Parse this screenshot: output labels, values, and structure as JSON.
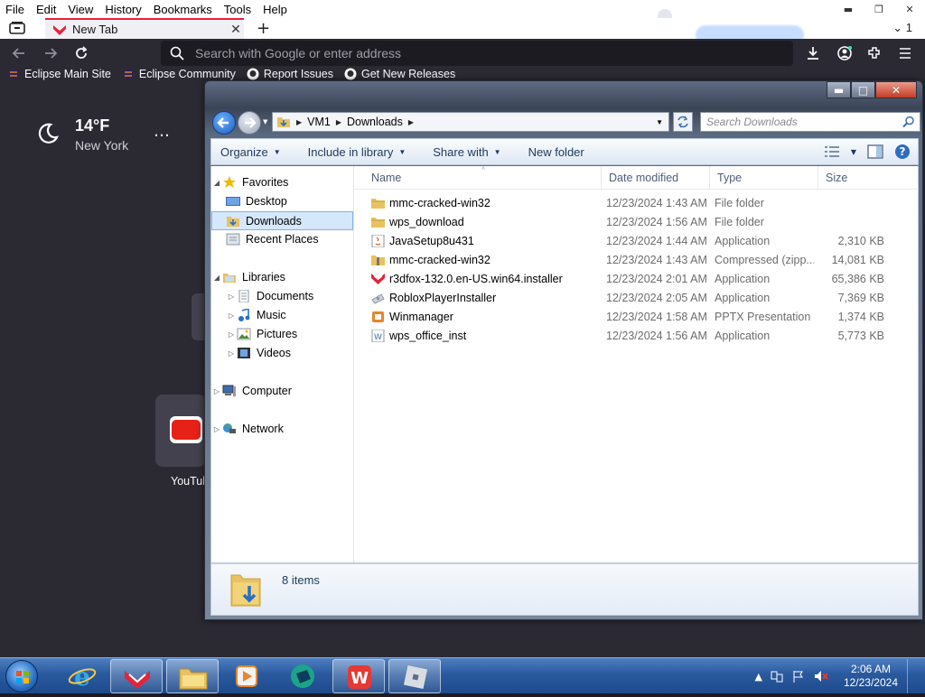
{
  "browser": {
    "menu": [
      "File",
      "Edit",
      "View",
      "History",
      "Bookmarks",
      "Tools",
      "Help"
    ],
    "tab_title": "New Tab",
    "tab_count": "1",
    "url_placeholder": "Search with Google or enter address",
    "bookmarks": [
      {
        "label": "Eclipse Main Site",
        "icon": "eclipse-icon"
      },
      {
        "label": "Eclipse Community",
        "icon": "eclipse-icon"
      },
      {
        "label": "Report Issues",
        "icon": "github-icon"
      },
      {
        "label": "Get New Releases",
        "icon": "github-icon"
      }
    ],
    "weather": {
      "temp": "14°F",
      "city": "New York"
    },
    "tiles": [
      {
        "label": "YouTube"
      }
    ]
  },
  "explorer": {
    "breadcrumb": [
      "VM1",
      "Downloads"
    ],
    "search_placeholder": "Search Downloads",
    "toolbar": {
      "organize": "Organize",
      "include": "Include in library",
      "share": "Share with",
      "new_folder": "New folder"
    },
    "nav": {
      "favorites": "Favorites",
      "desktop": "Desktop",
      "downloads": "Downloads",
      "recent": "Recent Places",
      "libraries": "Libraries",
      "documents": "Documents",
      "music": "Music",
      "pictures": "Pictures",
      "videos": "Videos",
      "computer": "Computer",
      "network": "Network"
    },
    "columns": {
      "name": "Name",
      "date": "Date modified",
      "type": "Type",
      "size": "Size"
    },
    "files": [
      {
        "name": "mmc-cracked-win32",
        "date": "12/23/2024 1:43 AM",
        "type": "File folder",
        "size": "",
        "icon": "folder-icon"
      },
      {
        "name": "wps_download",
        "date": "12/23/2024 1:56 AM",
        "type": "File folder",
        "size": "",
        "icon": "folder-icon"
      },
      {
        "name": "JavaSetup8u431",
        "date": "12/23/2024 1:44 AM",
        "type": "Application",
        "size": "2,310 KB",
        "icon": "java-icon"
      },
      {
        "name": "mmc-cracked-win32",
        "date": "12/23/2024 1:43 AM",
        "type": "Compressed (zipp...",
        "size": "14,081 KB",
        "icon": "zip-folder-icon"
      },
      {
        "name": "r3dfox-132.0.en-US.win64.installer",
        "date": "12/23/2024 2:01 AM",
        "type": "Application",
        "size": "65,386 KB",
        "icon": "r3dfox-icon"
      },
      {
        "name": "RobloxPlayerInstaller",
        "date": "12/23/2024 2:05 AM",
        "type": "Application",
        "size": "7,369 KB",
        "icon": "roblox-icon"
      },
      {
        "name": "Winmanager",
        "date": "12/23/2024 1:58 AM",
        "type": "PPTX Presentation",
        "size": "1,374 KB",
        "icon": "pptx-icon"
      },
      {
        "name": "wps_office_inst",
        "date": "12/23/2024 1:56 AM",
        "type": "Application",
        "size": "5,773 KB",
        "icon": "wps-icon"
      }
    ],
    "item_count": "8 items"
  },
  "taskbar": {
    "time": "2:06 AM",
    "date": "12/23/2024",
    "apps": [
      "ie-icon",
      "r3dfox-icon",
      "explorer-icon",
      "media-player-icon",
      "app-icon",
      "wps-icon",
      "roblox-icon"
    ]
  }
}
